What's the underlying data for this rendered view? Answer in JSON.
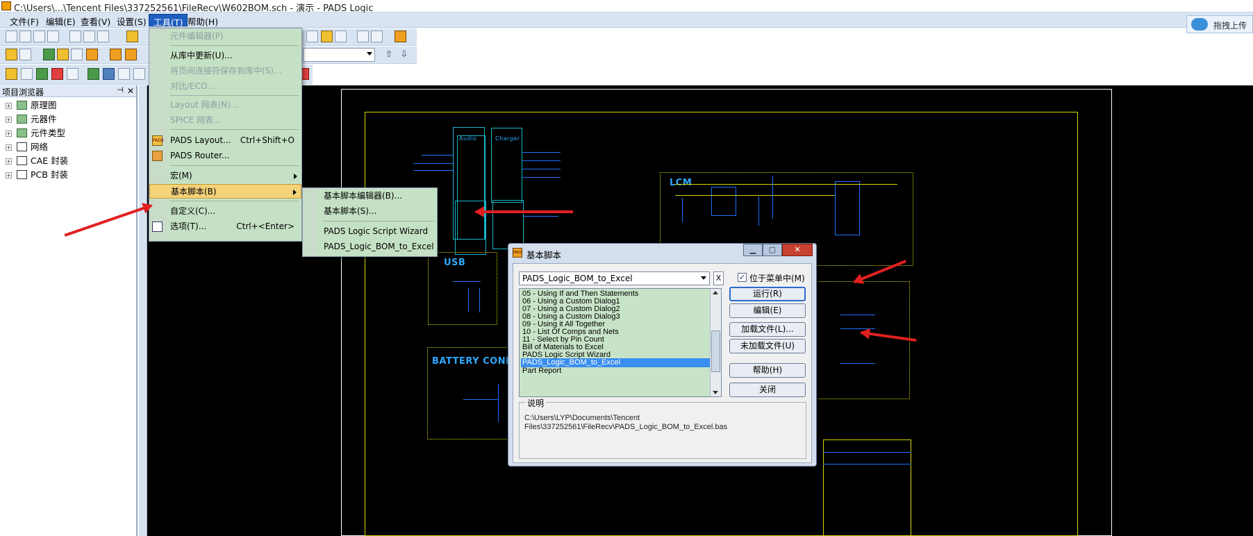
{
  "window": {
    "title": "C:\\Users\\...\\Tencent Files\\337252561\\FileRecv\\W602BOM.sch - 演示 - PADS Logic",
    "upload_label": "拖拽上传"
  },
  "menubar": {
    "items": [
      {
        "label": "文件(F)"
      },
      {
        "label": "编辑(E)"
      },
      {
        "label": "查看(V)"
      },
      {
        "label": "设置(S)"
      },
      {
        "label": "工具(T)"
      },
      {
        "label": "帮助(H)"
      }
    ]
  },
  "project_browser": {
    "title": "项目浏览器",
    "items": [
      {
        "label": "原理图"
      },
      {
        "label": "元器件"
      },
      {
        "label": "元件类型"
      },
      {
        "label": "网络"
      },
      {
        "label": "CAE 封装"
      },
      {
        "label": "PCB 封装"
      }
    ]
  },
  "tools_menu": {
    "items": [
      {
        "label": "元件编辑器(P)",
        "shortcut": "",
        "disabled": true
      },
      {
        "label": "从库中更新(U)...",
        "shortcut": "",
        "disabled": false
      },
      {
        "label": "将页间连接符保存到库中(S)...",
        "shortcut": "",
        "disabled": true
      },
      {
        "label": "对比/ECO...",
        "shortcut": "",
        "disabled": true
      },
      {
        "label": "Layout 网表(N)...",
        "shortcut": "",
        "disabled": true
      },
      {
        "label": "SPICE 网表...",
        "shortcut": "",
        "disabled": true
      },
      {
        "label": "PADS Layout...",
        "shortcut": "Ctrl+Shift+O",
        "disabled": false
      },
      {
        "label": "PADS Router...",
        "shortcut": "",
        "disabled": false
      },
      {
        "label": "宏(M)",
        "shortcut": "",
        "disabled": false
      },
      {
        "label": "基本脚本(B)",
        "shortcut": "",
        "disabled": false
      },
      {
        "label": "自定义(C)...",
        "shortcut": "",
        "disabled": false
      },
      {
        "label": "选项(T)...",
        "shortcut": "Ctrl+<Enter>",
        "disabled": false
      }
    ]
  },
  "basic_script_submenu": {
    "items": [
      {
        "label": "基本脚本编辑器(B)..."
      },
      {
        "label": "基本脚本(S)..."
      },
      {
        "label": "PADS Logic Script Wizard"
      },
      {
        "label": "PADS_Logic_BOM_to_Excel"
      }
    ]
  },
  "script_dialog": {
    "title": "基本脚本",
    "selected_script": "PADS_Logic_BOM_to_Excel",
    "x_label": "X",
    "in_menu_label": "位于菜单中(M)",
    "in_menu_checked": true,
    "scripts": [
      "05 - Using If and Then Statements",
      "06 - Using a Custom Dialog1",
      "07 - Using a Custom Dialog2",
      "08 - Using a Custom Dialog3",
      "09 - Using it All Together",
      "10 - List Of Comps and Nets",
      "11 - Select by Pin Count",
      "Bill of Materials to Excel",
      "PADS Logic Script Wizard",
      "PADS_Logic_BOM_to_Excel",
      "Part Report"
    ],
    "selected_index": 9,
    "buttons": {
      "run": "运行(R)",
      "edit": "编辑(E)",
      "load": "加载文件(L)...",
      "unload": "未加载文件(U)",
      "help": "帮助(H)",
      "close": "关闭"
    },
    "desc_label": "说明",
    "desc_text": "C:\\Users\\LYP\\Documents\\Tencent Files\\337252561\\FileRecv\\PADS_Logic_BOM_to_Excel.bas"
  },
  "schematic": {
    "blocks": [
      {
        "label": "LCM"
      },
      {
        "label": "USB"
      },
      {
        "label": "BATTERY CONN"
      }
    ],
    "ic_sections": [
      {
        "label": "Audio"
      },
      {
        "label": "Charger"
      }
    ]
  }
}
